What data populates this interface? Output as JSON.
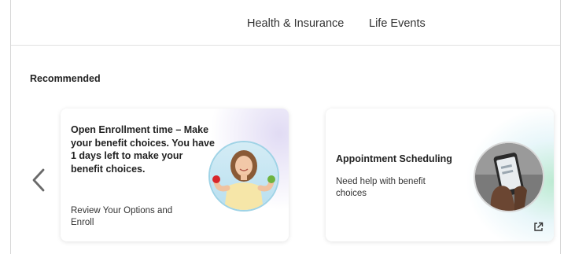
{
  "nav": {
    "items": [
      "Health & Insurance",
      "Life Events"
    ]
  },
  "recommended": {
    "title": "Recommended",
    "cards": [
      {
        "title": "Open Enrollment time – Make your benefit choices. You have 1 days left to make your benefit choices.",
        "subtitle": "Review Your Options and Enroll",
        "image": "woman-with-apples-icon"
      },
      {
        "title": "Appointment Scheduling",
        "subtitle": "Need help with benefit choices",
        "image": "hand-holding-phone-icon",
        "action_icon": "external-link-icon"
      }
    ]
  },
  "colors": {
    "accent_ring": "#9fd3e6",
    "glow_green": "#a0e1be",
    "glow_purple": "#c8beeb"
  }
}
